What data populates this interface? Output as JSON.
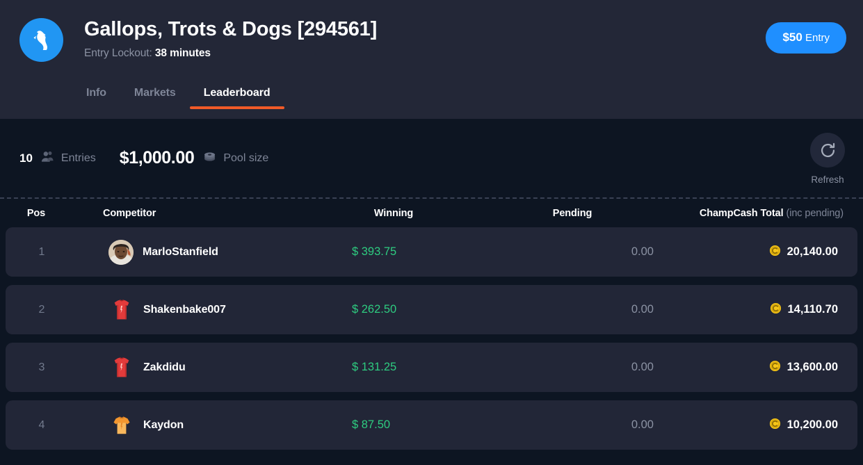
{
  "header": {
    "logo_icon": "horse-head-icon",
    "title": "Gallops, Trots & Dogs [294561]",
    "lockout_label": "Entry Lockout:",
    "lockout_value": "38 minutes",
    "entry_amount": "$50",
    "entry_label": "Entry",
    "accent_color": "#f05a28",
    "brand_blue": "#1f8fff"
  },
  "tabs": [
    {
      "label": "Info",
      "active": false
    },
    {
      "label": "Markets",
      "active": false
    },
    {
      "label": "Leaderboard",
      "active": true
    }
  ],
  "summary": {
    "entries_count": "10",
    "entries_icon": "users-icon",
    "entries_label": "Entries",
    "pool_amount": "$1,000.00",
    "pool_icon": "coins-stack-icon",
    "pool_label": "Pool size",
    "refresh_icon": "refresh-icon",
    "refresh_label": "Refresh"
  },
  "table": {
    "columns": {
      "pos": "Pos",
      "competitor": "Competitor",
      "winning": "Winning",
      "pending": "Pending",
      "champcash": "ChampCash Total",
      "champcash_sub": "(inc pending)"
    },
    "rows": [
      {
        "pos": "1",
        "avatar_type": "photo-avatar",
        "name": "MarloStanfield",
        "winning": "$ 393.75",
        "pending": "0.00",
        "champcash": "20,140.00"
      },
      {
        "pos": "2",
        "avatar_type": "red-silk-icon",
        "name": "Shakenbake007",
        "winning": "$ 262.50",
        "pending": "0.00",
        "champcash": "14,110.70"
      },
      {
        "pos": "3",
        "avatar_type": "red-silk-icon",
        "name": "Zakdidu",
        "winning": "$ 131.25",
        "pending": "0.00",
        "champcash": "13,600.00"
      },
      {
        "pos": "4",
        "avatar_type": "orange-shirt-icon",
        "name": "Kaydon",
        "winning": "$ 87.50",
        "pending": "0.00",
        "champcash": "10,200.00"
      }
    ]
  },
  "colors": {
    "page_bg": "#0d1522",
    "header_bg": "#232737",
    "row_bg": "#222637",
    "win_green": "#2ecc80",
    "coin_yellow": "#f5c518",
    "muted": "#7e8597"
  }
}
